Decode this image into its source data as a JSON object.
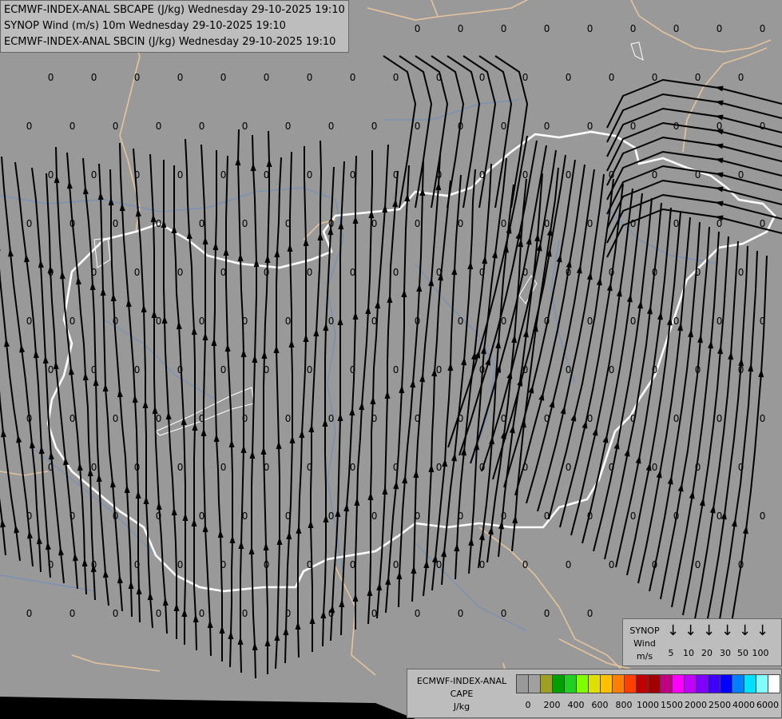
{
  "titles": [
    "ECMWF-INDEX-ANAL SBCAPE (J/kg) Wednesday 29-10-2025 19:10",
    "SYNOP Wind (m/s) 10m Wednesday 29-10-2025 19:10",
    "ECMWF-INDEX-ANAL SBCIN (J/kg) Wednesday 29-10-2025 19:10"
  ],
  "wind_legend": {
    "line1": "SYNOP",
    "line2": "Wind",
    "line3": "m/s",
    "speeds": [
      "5",
      "10",
      "20",
      "30",
      "50",
      "100"
    ]
  },
  "cape_legend": {
    "line1": "ECMWF-INDEX-ANAL",
    "line2": "CAPE",
    "line3": "J/kg",
    "ticks": [
      "0",
      "200",
      "400",
      "600",
      "800",
      "1000",
      "1500",
      "2000",
      "2500",
      "4000",
      "6000"
    ],
    "colors": [
      "#999999",
      "#a0a0a0",
      "#9fa020",
      "#00a000",
      "#20d020",
      "#80ff00",
      "#e0e000",
      "#ffc000",
      "#ff8000",
      "#ff4000",
      "#c00000",
      "#a00000",
      "#c00080",
      "#ff00ff",
      "#c000ff",
      "#8000ff",
      "#4000ff",
      "#0000ff",
      "#0080ff",
      "#00e0ff",
      "#80ffff",
      "#ffffff"
    ]
  },
  "map": {
    "background": "#999999",
    "border_color": "#ffffff",
    "neighbor_border_color": "#e5c49b",
    "river_color": "#6a8fc0",
    "streamline_color": "#000000",
    "zero_label": "0"
  }
}
